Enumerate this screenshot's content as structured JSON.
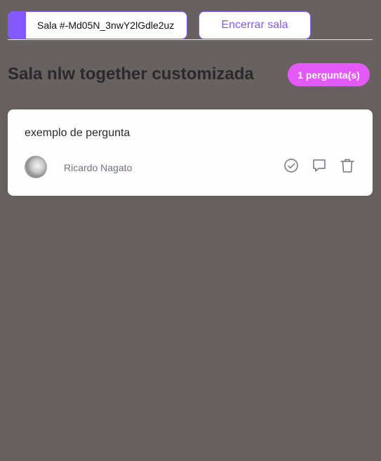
{
  "header": {
    "room_code_label": "Sala #-Md05N_3nwY2lGdle2uz",
    "close_room_label": "Encerrar sala"
  },
  "room": {
    "title": "Sala nlw together customizada",
    "question_count": "1 pergunta(s)"
  },
  "questions": [
    {
      "content": "exemplo de pergunta",
      "author": "Ricardo Nagato"
    }
  ],
  "icons": {
    "copy": "copy-icon",
    "check": "check-circle-icon",
    "answer": "chat-bubble-icon",
    "delete": "trash-icon"
  },
  "colors": {
    "background": "#67625f",
    "accent": "#835afd",
    "badge": "#e559f9",
    "card": "#fefefe",
    "title": "#29292e"
  }
}
